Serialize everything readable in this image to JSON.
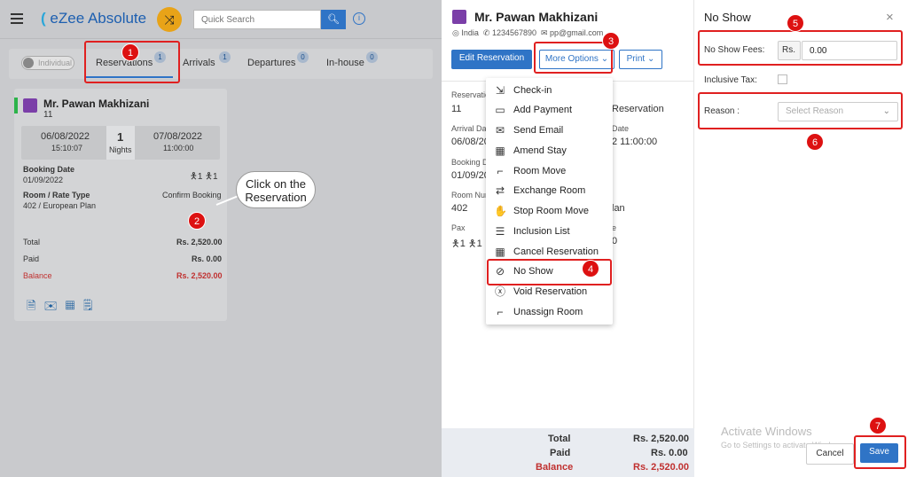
{
  "header": {
    "logo": "eZee Absolute",
    "search_placeholder": "Quick Search"
  },
  "tabs": {
    "individual": "Individual",
    "items": [
      {
        "label": "Reservations",
        "count": "1"
      },
      {
        "label": "Arrivals",
        "count": "1"
      },
      {
        "label": "Departures",
        "count": "0"
      },
      {
        "label": "In-house",
        "count": "0"
      }
    ]
  },
  "card": {
    "guest": "Mr. Pawan Makhizani",
    "guest_count": "11",
    "arrival": "06/08/2022",
    "arrival_time": "15:10:07",
    "nights": "1",
    "nights_label": "Nights",
    "departure": "07/08/2022",
    "departure_time": "11:00:00",
    "booking_date_label": "Booking Date",
    "booking_date": "01/09/2022",
    "pax_adults": "1",
    "pax_children": "1",
    "room_rate_label": "Room / Rate Type",
    "room_rate": "402 / European Plan",
    "status": "Confirm Booking",
    "total_label": "Total",
    "total": "Rs. 2,520.00",
    "paid_label": "Paid",
    "paid": "Rs. 0.00",
    "balance_label": "Balance",
    "balance": "Rs. 2,520.00"
  },
  "callout": "Click on the Reservation",
  "steps": [
    "1",
    "2",
    "3",
    "4",
    "5",
    "6",
    "7"
  ],
  "detail": {
    "guest": "Mr. Pawan Makhizani",
    "country": "India",
    "phone": "1234567890",
    "email": "pp@gmail.com",
    "edit": "Edit Reservation",
    "more": "More Options",
    "print": "Print",
    "res_label": "Reservation",
    "res_value": "11",
    "res_type": "Reservation",
    "arrival_label": "Arrival Date",
    "arrival_value": "06/08/2022",
    "departure_label": "Date",
    "departure_value": "2 11:00:00",
    "booking_label": "Booking Da",
    "booking_value": "01/09/20",
    "room_label": "Room Num",
    "room_value": "402",
    "plan": "lan",
    "pax_label": "Pax",
    "pax_adults": "1",
    "pax_children": "1",
    "rate_label": "e",
    "rate_value": "0",
    "total_label": "Total",
    "total": "Rs. 2,520.00",
    "paid_label": "Paid",
    "paid": "Rs. 0.00",
    "balance_label": "Balance",
    "balance": "Rs. 2,520.00"
  },
  "menu": [
    "Check-in",
    "Add Payment",
    "Send Email",
    "Amend Stay",
    "Room Move",
    "Exchange Room",
    "Stop Room Move",
    "Inclusion List",
    "Cancel Reservation",
    "No Show",
    "Void Reservation",
    "Unassign Room"
  ],
  "noshow": {
    "title": "No Show",
    "fees_label": "No Show Fees:",
    "currency": "Rs.",
    "fees_value": "0.00",
    "inclusive_label": "Inclusive Tax:",
    "reason_label": "Reason :",
    "reason_placeholder": "Select Reason",
    "cancel": "Cancel",
    "save": "Save"
  },
  "watermark": {
    "line1": "Activate Windows",
    "line2": "Go to Settings to activate Windows."
  },
  "colors": {
    "accent": "#2f74c6",
    "step": "#d11111",
    "balance": "#c0302f"
  }
}
